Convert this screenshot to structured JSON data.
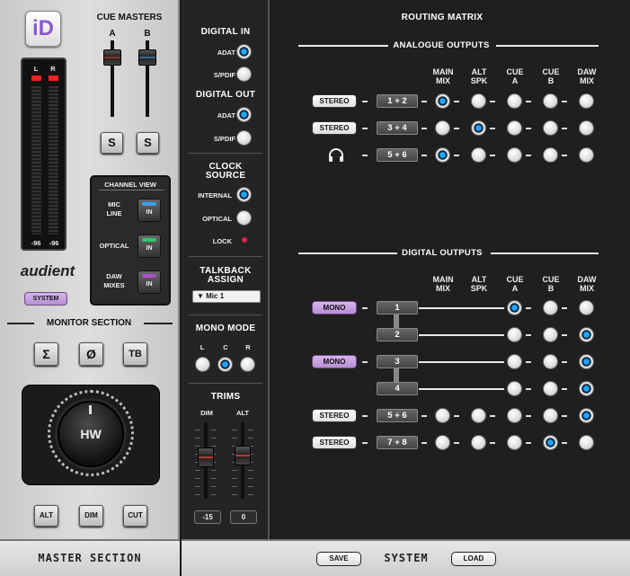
{
  "master": {
    "logo": "iD",
    "cue_masters": "CUE MASTERS",
    "cue_a": "A",
    "cue_b": "B",
    "meter_l": "L",
    "meter_r": "R",
    "meter_l_val": "-96",
    "meter_r_val": "-96",
    "solo_label": "S",
    "channel_view": "CHANNEL VIEW",
    "cv_items": [
      {
        "label1": "MIC",
        "label2": "LINE",
        "btn": "IN",
        "color": "#3aa0e8"
      },
      {
        "label1": "OPTICAL",
        "label2": "",
        "btn": "IN",
        "color": "#35c46a"
      },
      {
        "label1": "DAW",
        "label2": "MIXES",
        "btn": "IN",
        "color": "#b04fd0"
      }
    ],
    "brand": "audient",
    "system": "SYSTEM",
    "monitor_section": "MONITOR SECTION",
    "mon_btns": [
      "Σ",
      "Ø",
      "TB"
    ],
    "knob": "HW",
    "bottom_btns": [
      "ALT",
      "DIM",
      "CUT"
    ],
    "footer": "MASTER SECTION"
  },
  "mid": {
    "digital_in": "DIGITAL IN",
    "adat": "ADAT",
    "spdif": "S/PDIF",
    "digital_out": "DIGITAL OUT",
    "clock_source_1": "CLOCK",
    "clock_source_2": "SOURCE",
    "internal": "INTERNAL",
    "optical": "OPTICAL",
    "lock": "LOCK",
    "talkback_1": "TALKBACK",
    "talkback_2": "ASSIGN",
    "talkback_value": "▼ Mic 1",
    "mono_mode": "MONO MODE",
    "mono_l": "L",
    "mono_c": "C",
    "mono_r": "R",
    "trims": "TRIMS",
    "dim": "DIM",
    "alt": "ALT",
    "dim_val": "-15",
    "alt_val": "0"
  },
  "matrix": {
    "title": "ROUTING MATRIX",
    "analogue": "ANALOGUE OUTPUTS",
    "digital": "DIGITAL OUTPUTS",
    "cols": [
      [
        "MAIN",
        "MIX"
      ],
      [
        "ALT",
        "SPK"
      ],
      [
        "CUE",
        "A"
      ],
      [
        "CUE",
        "B"
      ],
      [
        "DAW",
        "MIX"
      ]
    ],
    "analogue_rows": [
      {
        "tag": "STEREO",
        "ch": "1 + 2",
        "sel": 0
      },
      {
        "tag": "STEREO",
        "ch": "3 + 4",
        "sel": 1
      },
      {
        "tag": "headphones-icon",
        "ch": "5 + 6",
        "sel": 0
      }
    ],
    "digital_rows": [
      {
        "tag": "MONO",
        "ch": "1",
        "sel": 2,
        "start": 2
      },
      {
        "tag": "",
        "ch": "2",
        "sel": 4,
        "start": 2
      },
      {
        "tag": "MONO",
        "ch": "3",
        "sel": 4,
        "start": 2
      },
      {
        "tag": "",
        "ch": "4",
        "sel": 4,
        "start": 2
      },
      {
        "tag": "STEREO",
        "ch": "5 + 6",
        "sel": 4,
        "start": 0
      },
      {
        "tag": "STEREO",
        "ch": "7 + 8",
        "sel": 3,
        "start": 0
      }
    ]
  },
  "footer": {
    "save": "SAVE",
    "system": "SYSTEM",
    "load": "LOAD"
  }
}
